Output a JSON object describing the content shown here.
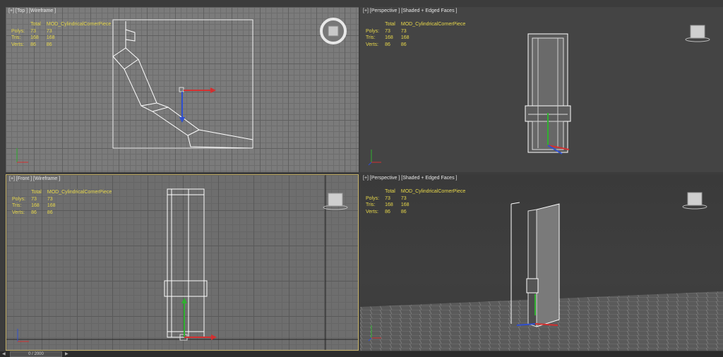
{
  "viewports": [
    {
      "id": "top",
      "label": "[+] [Top ] [Wireframe ]"
    },
    {
      "id": "perspective1",
      "label": "[+] [Perspective ] [Shaded + Edged Faces ]"
    },
    {
      "id": "front",
      "label": "[+] [Front ] [Wireframe ]"
    },
    {
      "id": "perspective2",
      "label": "[+] [Perspective ] [Shaded + Edged Faces ]"
    }
  ],
  "stats": {
    "header_total": "Total",
    "header_object": "MOD_CylindricalCornerPiece",
    "rows": [
      {
        "label": "Polys:",
        "total": "73",
        "object": "73"
      },
      {
        "label": "Tris:",
        "total": "168",
        "object": "168"
      },
      {
        "label": "Verts:",
        "total": "86",
        "object": "86"
      }
    ]
  },
  "timeline": {
    "frame_display": "0 / 2000"
  },
  "icons": [
    "viewcube-icon",
    "steering-wheel-icon",
    "axis-tripod-icon",
    "transform-gizmo-icon"
  ],
  "colors": {
    "stats_text": "#e8d84a",
    "active_border": "#c8b46a",
    "x_axis": "#d23030",
    "y_axis": "#30b030",
    "z_axis": "#3050d0"
  }
}
